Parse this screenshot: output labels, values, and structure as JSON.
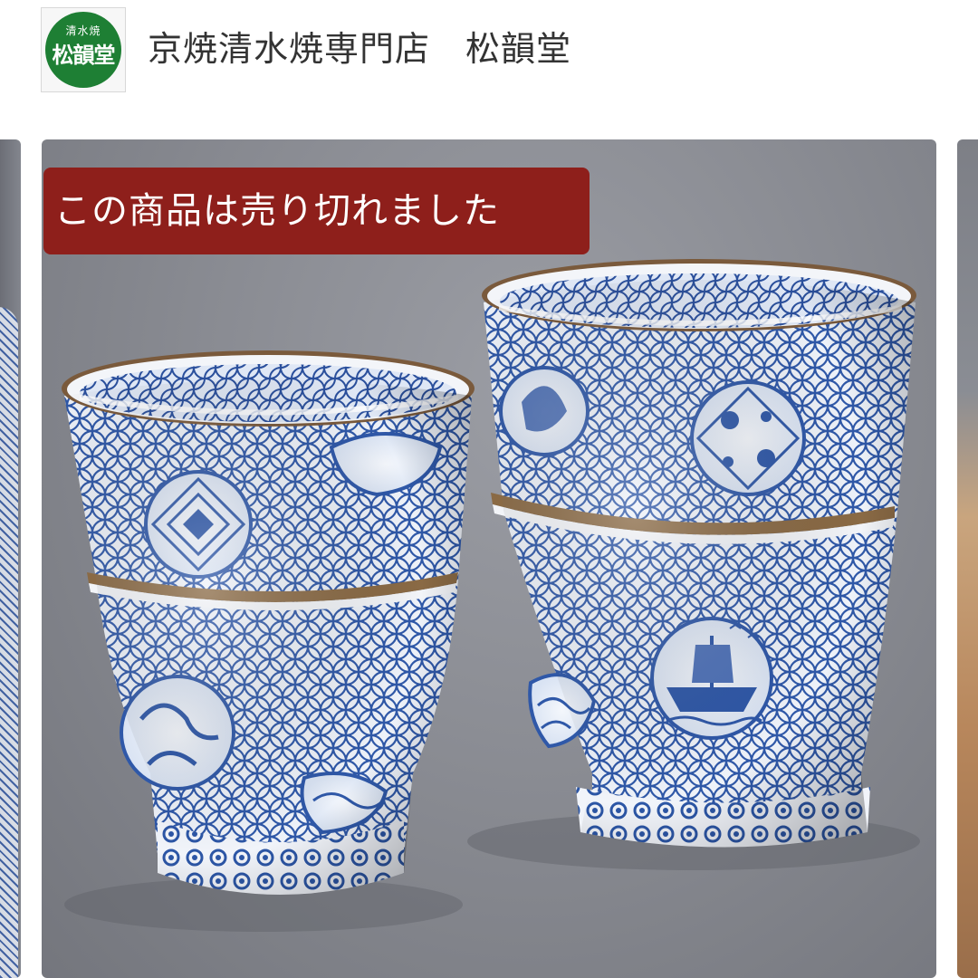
{
  "header": {
    "logo": {
      "small_text": "清水焼",
      "big_text": "松韻堂",
      "color": "#1e7f34"
    },
    "shop_name": "京焼清水焼専門店　松韻堂"
  },
  "product": {
    "sold_out_label": "この商品は売り切れました",
    "sold_out_color": "#8e1f1b",
    "image_subject": "two blue-and-white porcelain teacups"
  }
}
